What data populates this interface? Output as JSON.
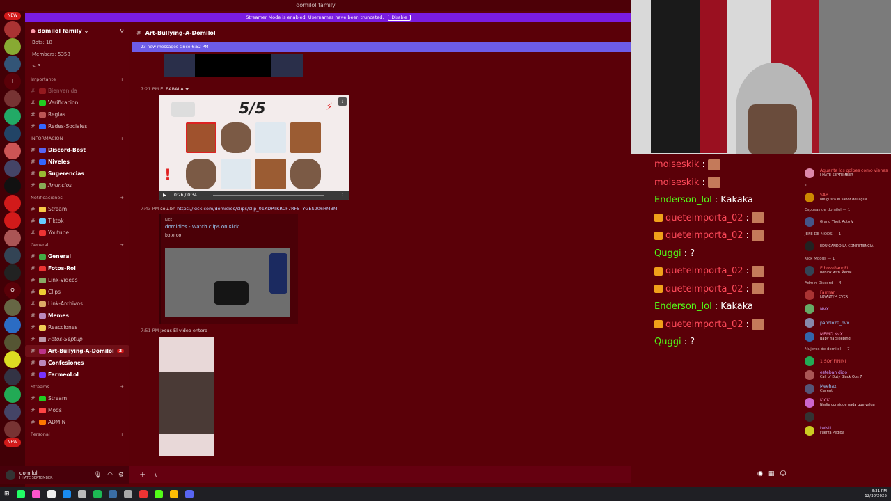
{
  "window": {
    "title": "domilol family"
  },
  "streamer_banner": {
    "text": "Streamer Mode is enabled. Usernames have been truncated.",
    "button": "Disable"
  },
  "server": {
    "name": "domilol family",
    "stats": [
      "Bots: 18",
      "Members: 5358",
      "< 3"
    ]
  },
  "sidebar": {
    "categories": [
      {
        "name": "Importante",
        "channels": [
          {
            "name": "Bienvenida",
            "muted": true
          },
          {
            "name": "Verificacion"
          },
          {
            "name": "Reglas"
          },
          {
            "name": "Redes-Sociales"
          }
        ]
      },
      {
        "name": "INFORMACION",
        "channels": [
          {
            "name": "Discord-Bost",
            "bold": true
          },
          {
            "name": "Niveles",
            "bold": true
          },
          {
            "name": "Sugerencias",
            "bold": true
          },
          {
            "name": "Anuncios",
            "italic": true
          }
        ]
      },
      {
        "name": "Notificaciones",
        "channels": [
          {
            "name": "Stream"
          },
          {
            "name": "Tiktok"
          },
          {
            "name": "Youtube"
          }
        ]
      },
      {
        "name": "General",
        "channels": [
          {
            "name": "General",
            "bold": true
          },
          {
            "name": "Fotos-Rol",
            "bold": true
          },
          {
            "name": "Link-Videos"
          },
          {
            "name": "Clips"
          },
          {
            "name": "Link-Archivos"
          },
          {
            "name": "Memes",
            "bold": true
          },
          {
            "name": "Reacciones"
          },
          {
            "name": "Fotos-Septup",
            "italic": true
          },
          {
            "name": "Art-Bullying-A-Domilol",
            "active": true,
            "badge": "2"
          },
          {
            "name": "Confesiones",
            "bold": true
          },
          {
            "name": "FarmeoLol",
            "bold": true
          }
        ]
      },
      {
        "name": "Streams",
        "channels": [
          {
            "name": "Stream"
          },
          {
            "name": "Mods"
          },
          {
            "name": "ADMIN"
          }
        ]
      },
      {
        "name": "Personal",
        "channels": []
      }
    ]
  },
  "user_panel": {
    "name": "domilol",
    "status": "I HATE SEPTEMBER"
  },
  "channel_header": {
    "name": "Art-Bullying-A-Domilol"
  },
  "new_messages_bar": "23 new messages since 6:52 PM",
  "messages": [
    {
      "time": "7:21 PM",
      "author": "ELEABALA"
    },
    {
      "score": "5/5",
      "video_time": "0:26 / 0:34"
    },
    {
      "time": "7:43 PM",
      "author": "sou.bn",
      "link": "https://kick.com/domidios/clips/clip_01KDPTKRCF7RF5TYGES906HMBM"
    },
    {
      "provider": "Kick",
      "title": "domidios - Watch clips on Kick",
      "description": "boteroo"
    },
    {
      "time": "7:51 PM",
      "author": "Jxsus",
      "text": "El video entero"
    }
  ],
  "composer": {
    "placeholder": "\\"
  },
  "stream_chat": [
    {
      "user": "moiseskik",
      "color": "#ff4a5a",
      "msg": ":",
      "emote": true
    },
    {
      "user": "moiseskik",
      "color": "#ff4a5a",
      "msg": ":",
      "emote": true
    },
    {
      "user": "Enderson_lol",
      "color": "#53fc18",
      "msg": ": Kakaka"
    },
    {
      "user": "queteimporta_02",
      "color": "#ff4a5a",
      "msg": ":",
      "emote": true,
      "badge": true
    },
    {
      "user": "queteimporta_02",
      "color": "#ff4a5a",
      "msg": ":",
      "emote": true,
      "badge": true
    },
    {
      "user": "Quggi",
      "color": "#53fc18",
      "msg": ": ?"
    },
    {
      "user": "queteimporta_02",
      "color": "#ff4a5a",
      "msg": ":",
      "emote": true,
      "badge": true
    },
    {
      "user": "queteimporta_02",
      "color": "#ff4a5a",
      "msg": ":",
      "emote": true,
      "badge": true
    },
    {
      "user": "Enderson_lol",
      "color": "#53fc18",
      "msg": ": Kakaka"
    },
    {
      "user": "queteimporta_02",
      "color": "#ff4a5a",
      "msg": ":",
      "emote": true,
      "badge": true
    },
    {
      "user": "Quggi",
      "color": "#53fc18",
      "msg": ": ?"
    }
  ],
  "members": [
    {
      "group": "",
      "items": [
        {
          "name": "Aguanta los golpes como vienes",
          "status": "I HATE SEPTEMBER"
        }
      ]
    },
    {
      "group": "1",
      "items": [
        {
          "name": "SAB",
          "status": "Me gusta el sabor del agua"
        }
      ]
    },
    {
      "group": "Esposas de domilol — 1",
      "items": [
        {
          "name": "",
          "status": "Grand Theft Auto V"
        }
      ]
    },
    {
      "group": "JEFE DE MODS — 1",
      "items": [
        {
          "name": "",
          "status": "EDU CANDO LA COMPETENCIA"
        }
      ]
    },
    {
      "group": "Kick Moods — 1",
      "items": [
        {
          "name": "ElbossGangFt",
          "status": "Roblox with Medal"
        }
      ]
    },
    {
      "group": "Admin-Discord — 4",
      "items": [
        {
          "name": "Farmar",
          "status": "LOYALTY 4 EVER"
        },
        {
          "name": "NVX",
          "status": ""
        },
        {
          "name": "papolo20_nvx",
          "status": ""
        },
        {
          "name": "MEMO.NvX",
          "status": "Baby na Sleeping"
        }
      ]
    },
    {
      "group": "Mujeres de domilol — 7",
      "items": [
        {
          "name": "1 SOY FININI",
          "status": ""
        },
        {
          "name": "esteban dido",
          "status": "Call of Duty Black Ops 7"
        },
        {
          "name": "Meehax",
          "status": "Clarent"
        },
        {
          "name": "KICK",
          "status": "Nadie consigue nada que valga"
        },
        {
          "name": "",
          "status": ""
        },
        {
          "name": "twistt",
          "status": "Fuerza Pegida"
        }
      ]
    }
  ],
  "clock": {
    "time": "8:31 PM",
    "date": "12/30/2025"
  },
  "colors": {
    "bg": "#5a0008",
    "sidebar": "#5b0009",
    "accent": "#7a1ce0",
    "new_bar": "#6d5ce8",
    "kick_green": "#53fc18"
  }
}
